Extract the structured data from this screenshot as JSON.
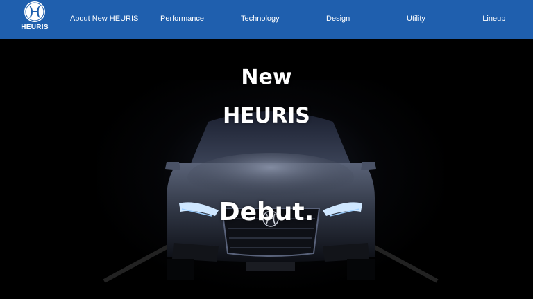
{
  "brand": {
    "name": "HEURIS",
    "accent_color": "#1f5fae"
  },
  "nav": {
    "items": [
      {
        "label": "About New HEURIS"
      },
      {
        "label": "Performance"
      },
      {
        "label": "Technology"
      },
      {
        "label": "Design"
      },
      {
        "label": "Utility"
      },
      {
        "label": "Lineup"
      }
    ]
  },
  "hero": {
    "line1": "New",
    "line2": "HEURIS",
    "line3": "Debut.",
    "image": "car-front-headlights-dark"
  },
  "icons": {
    "logo": "heuris-emblem-icon"
  }
}
